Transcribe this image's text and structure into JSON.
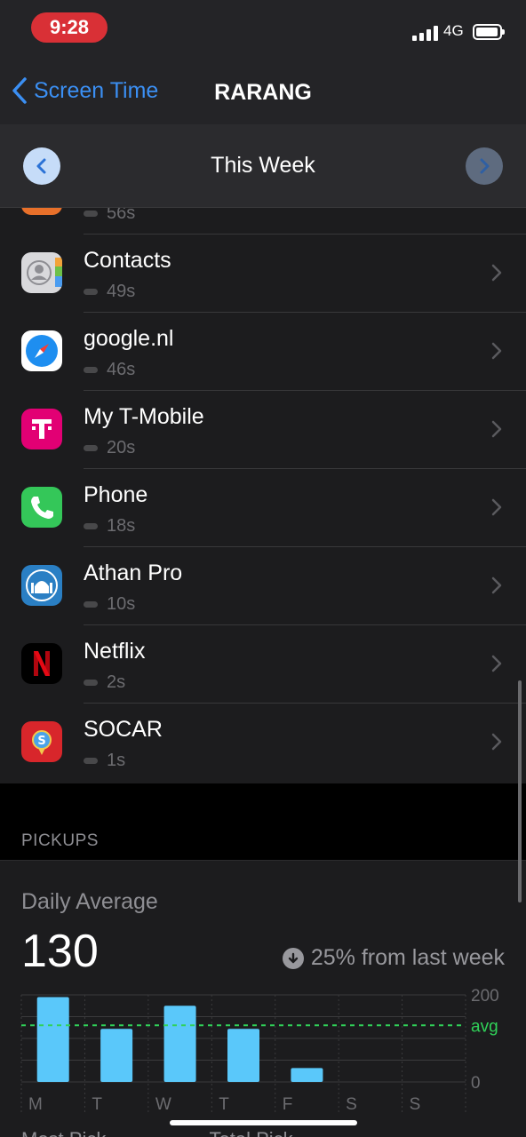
{
  "status_bar": {
    "time": "9:28",
    "network": "4G"
  },
  "nav": {
    "back_label": "Screen Time",
    "title": "RARANG"
  },
  "week": {
    "title": "This Week"
  },
  "apps": [
    {
      "name": "",
      "duration": "56s",
      "icon": "partial-orange-app-icon",
      "color": "#e8702a"
    },
    {
      "name": "Contacts",
      "duration": "49s",
      "icon": "contacts-icon",
      "color": "#d8d8d8"
    },
    {
      "name": "google.nl",
      "duration": "46s",
      "icon": "safari-compass-icon",
      "color": "#1e8ef0"
    },
    {
      "name": "My T-Mobile",
      "duration": "20s",
      "icon": "t-mobile-icon",
      "color": "#e20074"
    },
    {
      "name": "Phone",
      "duration": "18s",
      "icon": "phone-icon",
      "color": "#34c759"
    },
    {
      "name": "Athan Pro",
      "duration": "10s",
      "icon": "mosque-icon",
      "color": "#2a7fc4"
    },
    {
      "name": "Netflix",
      "duration": "2s",
      "icon": "netflix-icon",
      "color": "#e50914"
    },
    {
      "name": "SOCAR",
      "duration": "1s",
      "icon": "socar-icon",
      "color": "#d8262b"
    }
  ],
  "pickups": {
    "section_label": "PICKUPS",
    "daily_average_label": "Daily Average",
    "daily_average_value": "130",
    "change_text": "25% from last week",
    "cut_off_labels": [
      "Most Pick",
      "Total Pick"
    ]
  },
  "chart_data": {
    "type": "bar",
    "categories": [
      "M",
      "T",
      "W",
      "T",
      "F",
      "S",
      "S"
    ],
    "values": [
      195,
      122,
      175,
      122,
      32,
      0,
      0
    ],
    "ylim": [
      0,
      200
    ],
    "y_ticks": [
      "200",
      "0"
    ],
    "avg_value": 130,
    "avg_label": "avg",
    "bar_color": "#5ac8fa",
    "avg_color": "#30d158",
    "grid": true
  }
}
